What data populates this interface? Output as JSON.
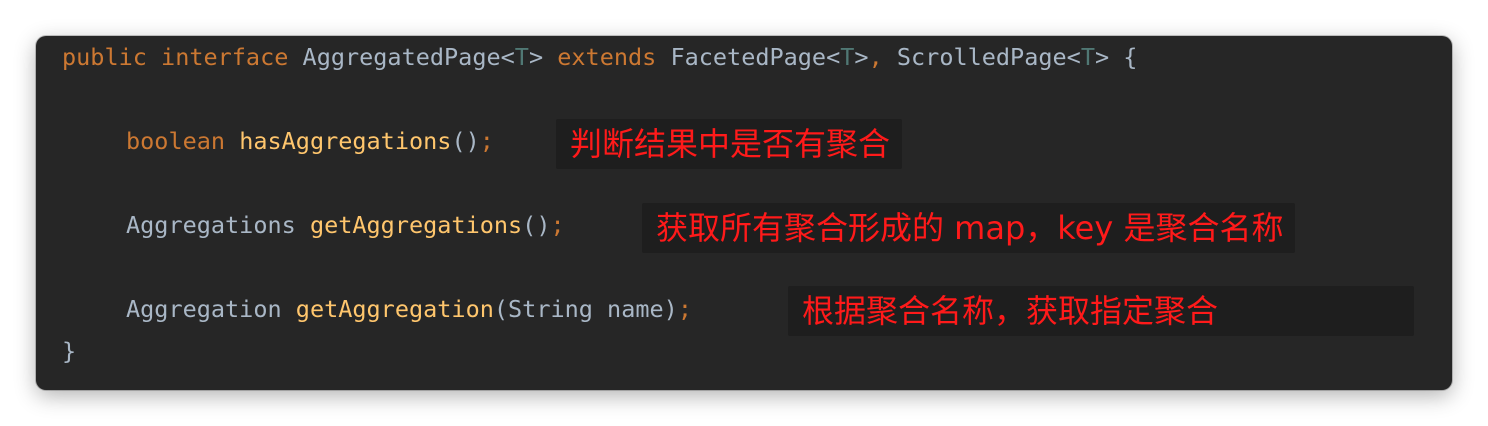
{
  "code": {
    "line1": {
      "kw_public": "public",
      "kw_interface": "interface",
      "type_name": "AggregatedPage",
      "lt1": "<",
      "gen1": "T",
      "gt1": ">",
      "kw_extends": "extends",
      "super1": "FacetedPage",
      "lt2": "<",
      "gen2": "T",
      "gt2": ">",
      "comma": ",",
      "super2": "ScrolledPage",
      "lt3": "<",
      "gen3": "T",
      "gt3": ">",
      "brace_open": "{"
    },
    "method1": {
      "return_type": "boolean",
      "name": "hasAggregations",
      "params": "()",
      "semicolon": ";"
    },
    "method2": {
      "return_type": "Aggregations",
      "name": "getAggregations",
      "params": "()",
      "semicolon": ";"
    },
    "method3": {
      "return_type": "Aggregation",
      "name": "getAggregation",
      "params": "(String name)",
      "semicolon": ";"
    },
    "brace_close": "}"
  },
  "annotations": {
    "note1": "判断结果中是否有聚合",
    "note2": "获取所有聚合形成的 map，key 是聚合名称",
    "note3": "根据聚合名称，获取指定聚合"
  },
  "colors": {
    "background": "#262626",
    "keyword": "#cc7832",
    "default_text": "#a9b7c6",
    "generic": "#507874",
    "method": "#ffc66d",
    "annotation_text": "#ff1a1a",
    "annotation_bg": "#1e1e1e"
  }
}
